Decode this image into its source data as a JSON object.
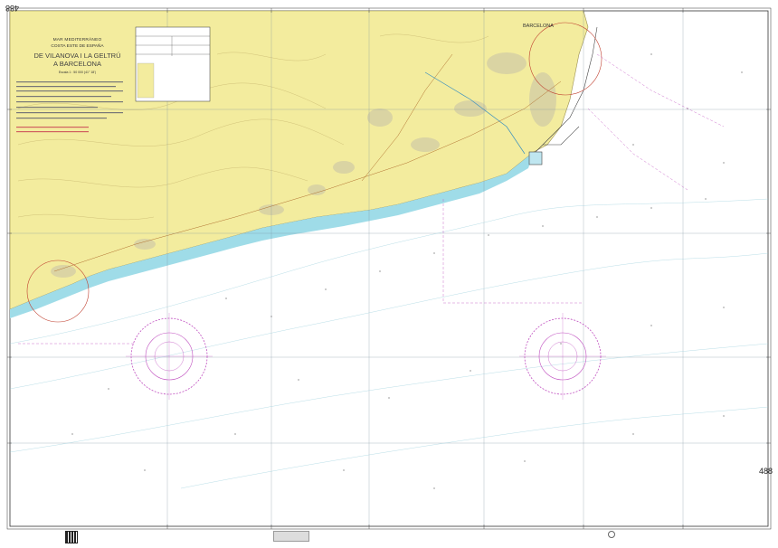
{
  "chart_number": "488",
  "title": {
    "sea": "MAR MEDITERRÁNEO",
    "coast": "COSTA ESTE DE ESPAÑA",
    "line1": "DE VILANOVA I LA GELTRÚ",
    "line2": "A BARCELONA",
    "scale": "Escala 1 : 50 000 (41° 18')"
  },
  "places": {
    "barcelona": "BARCELONA"
  },
  "colors": {
    "land": "#f3ec9e",
    "sea": "#ffffff",
    "shallow": "#bfe6f0",
    "nearshore": "#7fd3e0",
    "magenta": "#c050c0",
    "grid": "#7a8fa0",
    "urban": "#d7d0a0"
  }
}
